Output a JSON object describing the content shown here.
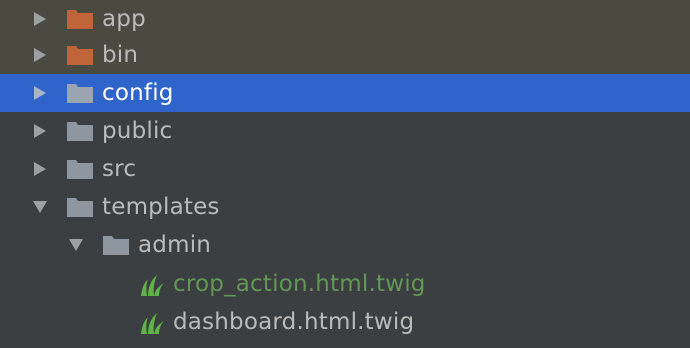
{
  "colors": {
    "background": "#3c3f41",
    "excluded_row": "#4b4a40",
    "selected_row": "#2f65ca",
    "folder_excluded": "#c0653a",
    "folder_default": "#8e979f",
    "twig_green": "#5fb347",
    "text_default": "#bbbbbb",
    "text_modified": "#629755"
  },
  "tree": {
    "items": [
      {
        "label": "app",
        "icon": "folder-excluded-icon",
        "arrow": "collapsed"
      },
      {
        "label": "bin",
        "icon": "folder-excluded-icon",
        "arrow": "collapsed"
      },
      {
        "label": "config",
        "icon": "folder-icon",
        "arrow": "collapsed",
        "selected": true
      },
      {
        "label": "public",
        "icon": "folder-icon",
        "arrow": "collapsed"
      },
      {
        "label": "src",
        "icon": "folder-icon",
        "arrow": "collapsed"
      },
      {
        "label": "templates",
        "icon": "folder-icon",
        "arrow": "expanded"
      },
      {
        "label": "admin",
        "icon": "folder-icon",
        "arrow": "expanded"
      },
      {
        "label": "crop_action.html.twig",
        "icon": "twig-file-icon",
        "status": "modified"
      },
      {
        "label": "dashboard.html.twig",
        "icon": "twig-file-icon"
      }
    ]
  }
}
